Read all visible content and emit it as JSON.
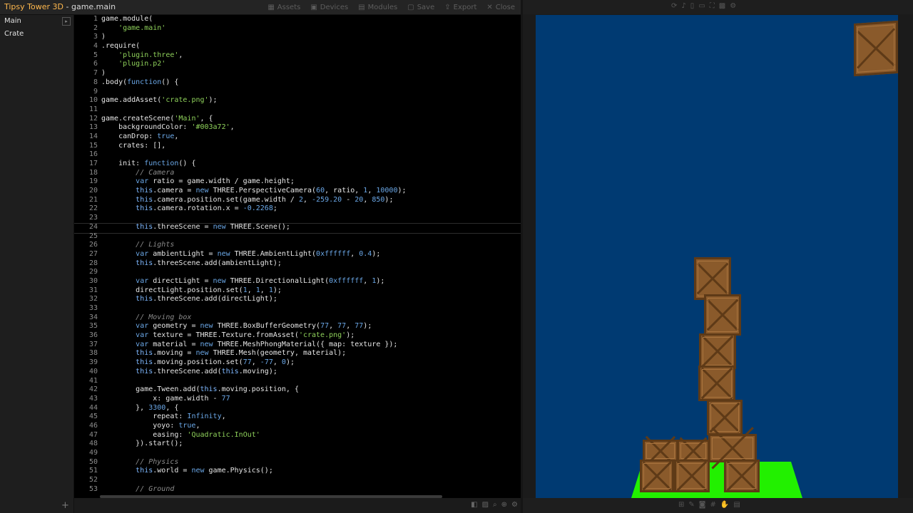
{
  "app": {
    "name": "Tipsy Tower 3D",
    "separator": " - ",
    "file": "game.main"
  },
  "menu": [
    {
      "label": "Assets",
      "icon": "assets-icon",
      "glyph": "▦"
    },
    {
      "label": "Devices",
      "icon": "devices-icon",
      "glyph": "▣"
    },
    {
      "label": "Modules",
      "icon": "modules-icon",
      "glyph": "▤"
    },
    {
      "label": "Save",
      "icon": "save-icon",
      "glyph": "▢"
    },
    {
      "label": "Export",
      "icon": "export-icon",
      "glyph": "⇪"
    },
    {
      "label": "Close",
      "icon": "close-icon",
      "glyph": "✕"
    }
  ],
  "sidebar": {
    "scenes": [
      {
        "label": "Main"
      },
      {
        "label": "Crate"
      }
    ],
    "play_glyph": "▸",
    "add_glyph": "+"
  },
  "editor": {
    "current_line": 24,
    "lines": [
      "<span>game.module(</span>",
      "    <span class=\"s\">'game.main'</span>",
      ")",
      ".require(",
      "    <span class=\"s\">'plugin.three'</span>,",
      "    <span class=\"s\">'plugin.p2'</span>",
      ")",
      ".body(<span class=\"k\">function</span>() {",
      "",
      "game.addAsset(<span class=\"s\">'crate.png'</span>);",
      "",
      "game.createScene(<span class=\"s\">'Main'</span>, {",
      "    backgroundColor: <span class=\"s\">'#003a72'</span>,",
      "    canDrop: <span class=\"n\">true</span>,",
      "    crates: [],",
      "",
      "    init: <span class=\"k\">function</span>() {",
      "        <span class=\"c\">// Camera</span>",
      "        <span class=\"k\">var</span> ratio = game.width / game.height;",
      "        <span class=\"t\">this</span>.camera = <span class=\"k\">new</span> THREE.PerspectiveCamera(<span class=\"n\">60</span>, ratio, <span class=\"n\">1</span>, <span class=\"n\">10000</span>);",
      "        <span class=\"t\">this</span>.camera.position.set(game.width / <span class=\"n\">2</span>, <span class=\"n\">-259.20</span> - <span class=\"n\">20</span>, <span class=\"n\">850</span>);",
      "        <span class=\"t\">this</span>.camera.rotation.x = <span class=\"n\">-0.2268</span>;",
      "",
      "        <span class=\"t\">this</span>.threeScene = <span class=\"k\">new</span> THREE.Scene();",
      "",
      "        <span class=\"c\">// Lights</span>",
      "        <span class=\"k\">var</span> ambientLight = <span class=\"k\">new</span> THREE.AmbientLight(<span class=\"n\">0xffffff</span>, <span class=\"n\">0.4</span>);",
      "        <span class=\"t\">this</span>.threeScene.add(ambientLight);",
      "",
      "        <span class=\"k\">var</span> directLight = <span class=\"k\">new</span> THREE.DirectionalLight(<span class=\"n\">0xffffff</span>, <span class=\"n\">1</span>);",
      "        directLight.position.set(<span class=\"n\">1</span>, <span class=\"n\">1</span>, <span class=\"n\">1</span>);",
      "        <span class=\"t\">this</span>.threeScene.add(directLight);",
      "",
      "        <span class=\"c\">// Moving box</span>",
      "        <span class=\"k\">var</span> geometry = <span class=\"k\">new</span> THREE.BoxBufferGeometry(<span class=\"n\">77</span>, <span class=\"n\">77</span>, <span class=\"n\">77</span>);",
      "        <span class=\"k\">var</span> texture = THREE.Texture.fromAsset(<span class=\"s\">'crate.png'</span>);",
      "        <span class=\"k\">var</span> material = <span class=\"k\">new</span> THREE.MeshPhongMaterial({ map: texture });",
      "        <span class=\"t\">this</span>.moving = <span class=\"k\">new</span> THREE.Mesh(geometry, material);",
      "        <span class=\"t\">this</span>.moving.position.set(<span class=\"n\">77</span>, <span class=\"n\">-77</span>, <span class=\"n\">0</span>);",
      "        <span class=\"t\">this</span>.threeScene.add(<span class=\"t\">this</span>.moving);",
      "",
      "        game.Tween.add(<span class=\"t\">this</span>.moving.position, {",
      "            x: game.width - <span class=\"n\">77</span>",
      "        }, <span class=\"n\">3300</span>, {",
      "            repeat: <span class=\"n\">Infinity</span>,",
      "            yoyo: <span class=\"n\">true</span>,",
      "            easing: <span class=\"s\">'Quadratic.InOut'</span>",
      "        }).start();",
      "",
      "        <span class=\"c\">// Physics</span>",
      "        <span class=\"t\">this</span>.world = <span class=\"k\">new</span> game.Physics();",
      "",
      "        <span class=\"c\">// Ground</span>"
    ]
  },
  "game_view": {
    "background": "#003a72",
    "ground_color": "#22f000"
  }
}
